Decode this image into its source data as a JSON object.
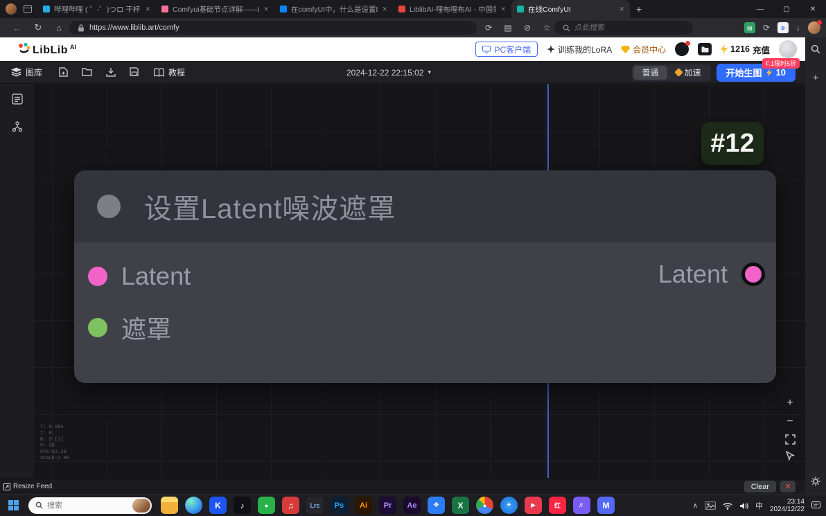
{
  "colors": {
    "accent_blue": "#2f6bff",
    "promo_red": "#ff3d5e",
    "badge_green_bg": "#1d2a19",
    "link_blue": "#3f62c6"
  },
  "icons": {
    "back": "←",
    "refresh": "↻",
    "home": "⌂",
    "cycle": "⟳",
    "reader": "▤",
    "block": "⊘",
    "star": "☆",
    "download": "↓",
    "extension_b": "b",
    "minimize": "—",
    "maximize": "▢",
    "close": "✕",
    "new_tab": "+",
    "tab_close": "✕",
    "caret_down": "▾",
    "sidebar_plus": "+",
    "zoom_in": "+",
    "zoom_out": "−",
    "chevron_up": "∧",
    "clear_x": "✕"
  },
  "browser": {
    "tabs": [
      {
        "title": "哔哩哔哩 ( ゜-゜)つロ 干杯~-bilibili",
        "icon_color": "#23ade5"
      },
      {
        "title": "Comfyui基础节点详解——Latent…",
        "icon_color": "#fb7299"
      },
      {
        "title": "在comfyUI中，什么是设置Latent!!",
        "icon_color": "#0a84ff"
      },
      {
        "title": "LiblibAI-哩布哩布AI - 中国领先的…",
        "icon_color": "#e8453c"
      },
      {
        "title": "在线ComfyUI",
        "icon_color": "#12b8a6"
      }
    ],
    "url": "https://www.liblib.art/comfy",
    "search_placeholder": "点此搜索"
  },
  "site_header": {
    "logo_text": "LibLib",
    "logo_sup": "AI",
    "pc_client": "PC客户端",
    "train_lora": "训练我的LoRA",
    "member_center": "会员中心",
    "credits_amount": "1216",
    "credits_action": "充值"
  },
  "comfy": {
    "toolbar": {
      "gallery": "图库",
      "tutorial": "教程",
      "timestamp": "2024-12-22 22:15:02",
      "mode_normal": "普通",
      "mode_boost": "加速",
      "generate": "开始生图",
      "generate_cost": "10",
      "promo": "F.1限时5折"
    },
    "node_badge": "#12",
    "node": {
      "title": "设置Latent噪波遮罩",
      "inputs": [
        {
          "label": "Latent",
          "color": "#f263c8"
        },
        {
          "label": "遮罩",
          "color": "#7ec35f"
        }
      ],
      "output": {
        "label": "Latent",
        "color": "#f263c8"
      }
    },
    "stats": [
      "T: 0.00s",
      "I: 0",
      "N: 9 [1]",
      "V: 30",
      "FPS:63.29",
      "SCALE:4.88"
    ],
    "bottom": {
      "resize_feed": "Resize Feed",
      "clear": "Clear"
    }
  },
  "taskbar": {
    "search_label": "搜索",
    "ime": "中",
    "time": "23:14",
    "date": "2024/12/22",
    "apps": [
      {
        "name": "file-explorer",
        "bg": "linear-gradient(180deg,#ffd969 32%,#f0b23c 32%)",
        "glyph": ""
      },
      {
        "name": "edge-browser",
        "bg": "radial-gradient(circle at 32% 28%,#7ff0c8,#2f8ded 65%,#1b5fd0)",
        "round": true,
        "glyph": ""
      },
      {
        "name": "kimi",
        "bg": "#1c55f2",
        "glyph": "K"
      },
      {
        "name": "douyin",
        "bg": "#0f0f14",
        "glyph": "♪"
      },
      {
        "name": "wechat",
        "bg": "#2ab24a",
        "glyph": "●",
        "size": 9
      },
      {
        "name": "red-music",
        "bg": "#d73a3a",
        "glyph": "♫"
      },
      {
        "name": "lightroom-classic",
        "bg": "#26262b",
        "glyph": "Lrc",
        "fg": "#7cb8ff",
        "size": 9
      },
      {
        "name": "photoshop",
        "bg": "#0c1f35",
        "glyph": "Ps",
        "fg": "#31a8ff",
        "size": 11
      },
      {
        "name": "illustrator",
        "bg": "#2b1600",
        "glyph": "Ai",
        "fg": "#ff9a00",
        "size": 11
      },
      {
        "name": "premiere",
        "bg": "#1d0b33",
        "glyph": "Pr",
        "fg": "#b49bff",
        "size": 11
      },
      {
        "name": "after-effects",
        "bg": "#1a0b2e",
        "glyph": "Ae",
        "fg": "#a78bfa",
        "size": 11
      },
      {
        "name": "blue-app",
        "bg": "#2e7bf6",
        "glyph": "❖",
        "size": 10
      },
      {
        "name": "excel",
        "bg": "#1a7343",
        "glyph": "X"
      },
      {
        "name": "chrome",
        "bg": "conic-gradient(#ea4335 0 33%,#4285f4 33% 66%,#34a853 66% 88%,#fbbc05 88%)",
        "round": true,
        "glyph": "●",
        "size": 9
      },
      {
        "name": "safari",
        "bg": "radial-gradient(circle,#3ba0f5,#1b6fd8)",
        "round": true,
        "glyph": "✦",
        "size": 10
      },
      {
        "name": "red-video",
        "bg": "#e93a4e",
        "glyph": "▶",
        "size": 9
      },
      {
        "name": "xiaohongshu",
        "bg": "#ff2442",
        "glyph": "红",
        "size": 9
      },
      {
        "name": "purple-music",
        "bg": "#7b5bf5",
        "glyph": "♬",
        "size": 10
      },
      {
        "name": "blue-m",
        "bg": "#5468f5",
        "glyph": "M"
      }
    ]
  }
}
